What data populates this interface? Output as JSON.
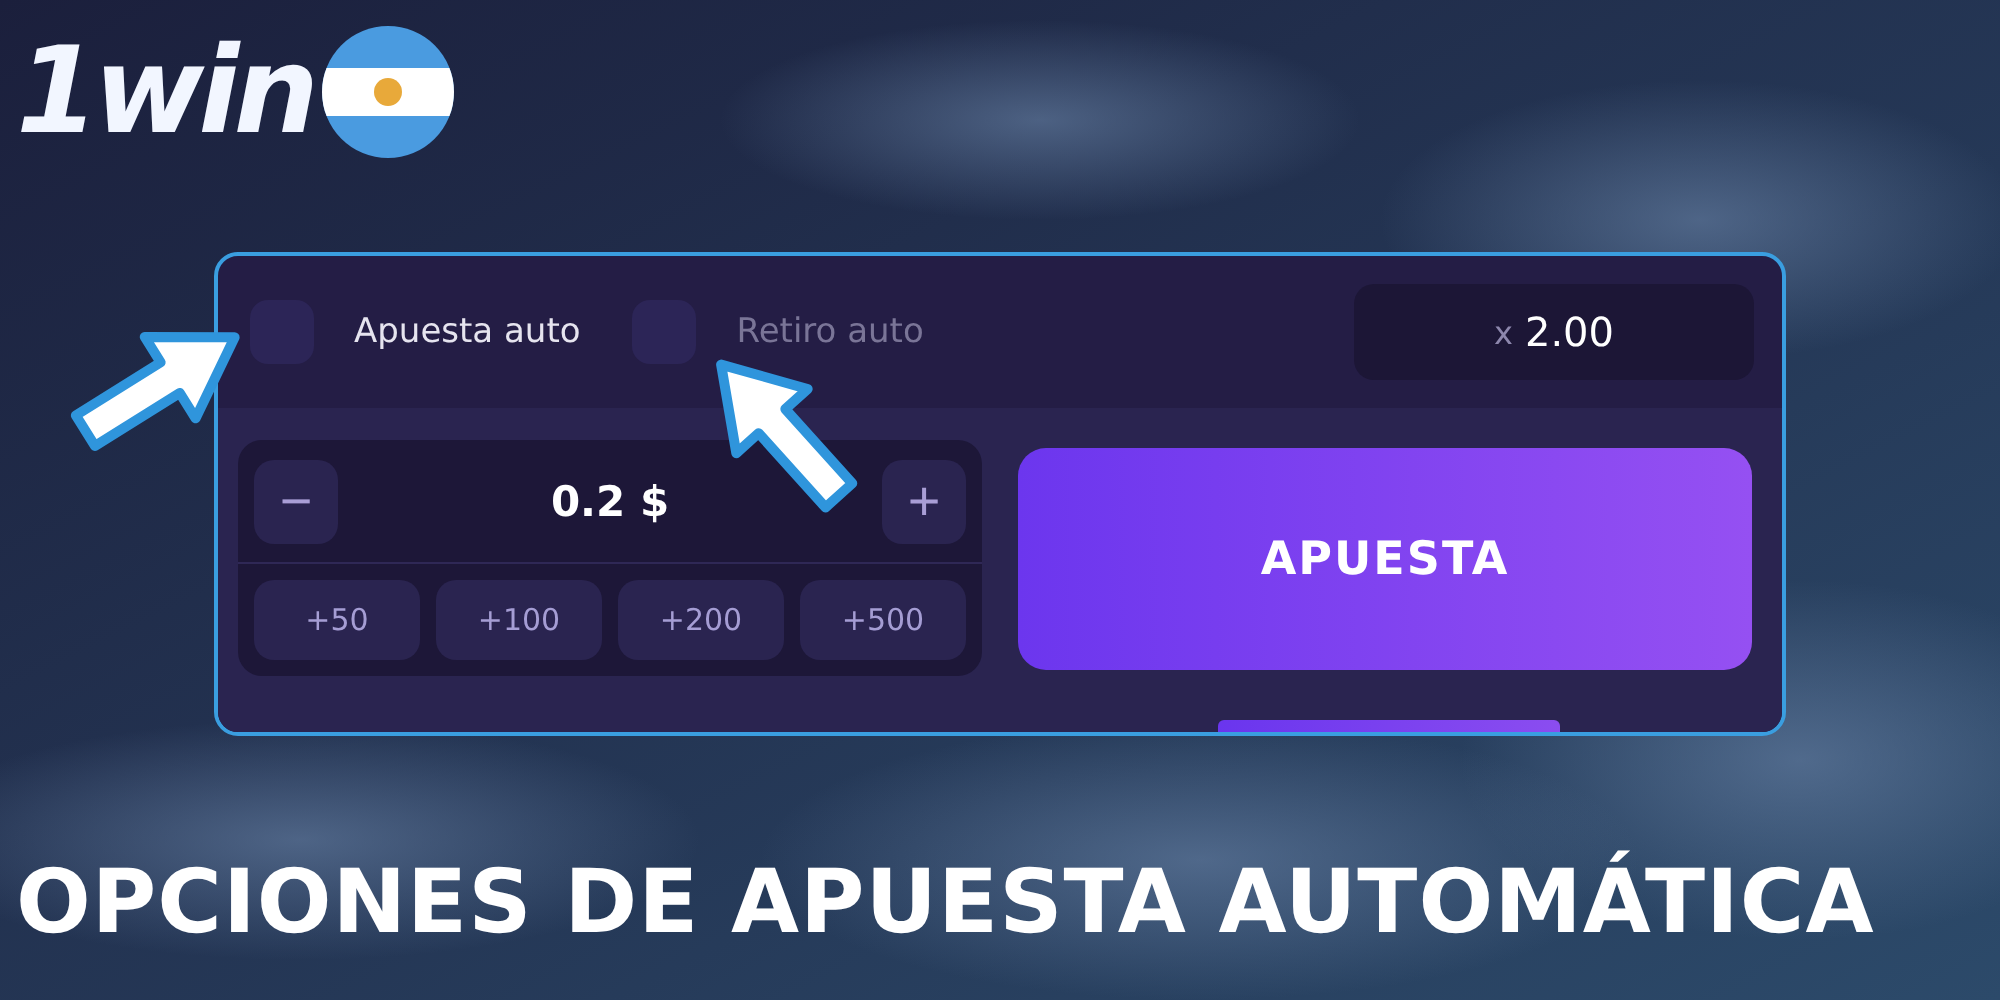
{
  "logo": {
    "text": "1win"
  },
  "panel": {
    "options": [
      {
        "label": "Apuesta auto",
        "checked": false,
        "disabled": false
      },
      {
        "label": "Retiro auto",
        "checked": false,
        "disabled": true
      }
    ],
    "multiplier": {
      "prefix": "x",
      "value": "2.00"
    },
    "stake": {
      "minus": "−",
      "value": "0.2 $",
      "plus": "+",
      "quick": [
        "+50",
        "+100",
        "+200",
        "+500"
      ]
    },
    "bet_button": "APUESTA"
  },
  "caption": "OPCIONES DE APUESTA AUTOMÁTICA"
}
